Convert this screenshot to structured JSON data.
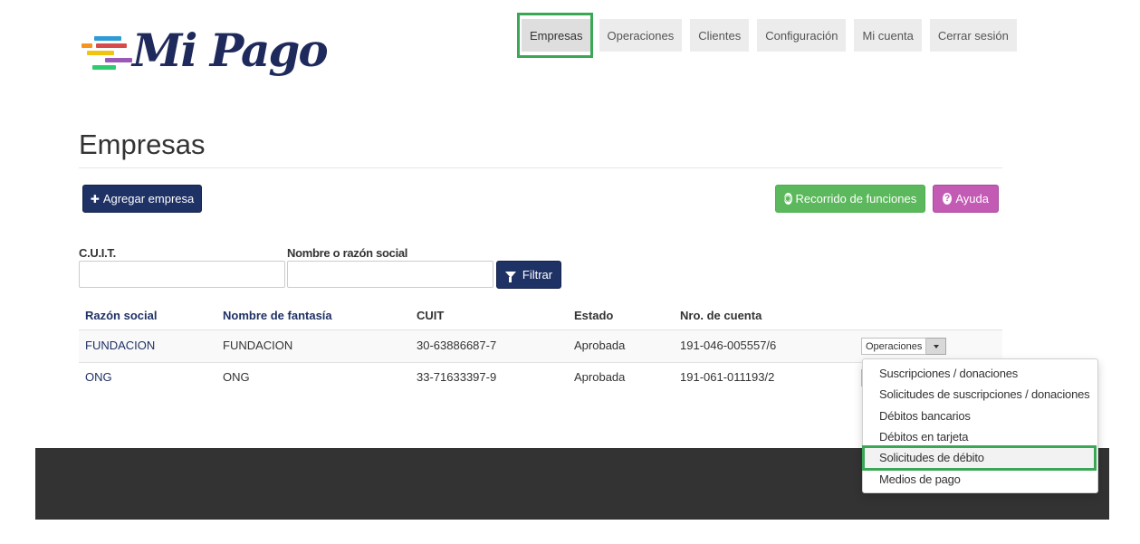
{
  "brand": {
    "name": "Mi Pago",
    "stripe_colors": [
      "#f7941d",
      "#d64c4c",
      "#9b59b6",
      "#2e9bd6",
      "#f1c40f",
      "#2ecc71"
    ],
    "text_color": "#1f2a5c"
  },
  "nav": {
    "items": [
      {
        "label": "Empresas",
        "active": true
      },
      {
        "label": "Operaciones"
      },
      {
        "label": "Clientes"
      },
      {
        "label": "Configuración"
      },
      {
        "label": "Mi cuenta"
      },
      {
        "label": "Cerrar sesión"
      }
    ]
  },
  "page": {
    "title": "Empresas"
  },
  "actions": {
    "add_company": "Agregar empresa",
    "tour": "Recorrido de funciones",
    "help": "Ayuda"
  },
  "filter": {
    "cuit_label": "C.U.I.T.",
    "cuit_value": "",
    "name_label": "Nombre o razón social",
    "name_value": "",
    "button": "Filtrar"
  },
  "table": {
    "headers": [
      "Razón social",
      "Nombre de fantasía",
      "CUIT",
      "Estado",
      "Nro. de cuenta"
    ],
    "rows": [
      [
        "FUNDACION",
        "FUNDACION",
        "30-63886687-7",
        "Aprobada",
        "191-046-005557/6"
      ],
      [
        "ONG",
        "ONG",
        "33-71633397-9",
        "Aprobada",
        "191-061-011193/2"
      ]
    ],
    "row_action": "Operaciones"
  },
  "dropdown": {
    "items": [
      "Suscripciones / donaciones",
      "Solicitudes de suscripciones / donaciones",
      "Débitos bancarios",
      "Débitos en tarjeta",
      "Solicitudes de débito",
      "Medios de pago"
    ],
    "highlighted_index": 4
  },
  "colors": {
    "primary": "#1f3265",
    "success": "#5cb85c",
    "help": "#c35ab3",
    "highlight": "#3aa757",
    "footer": "#333333"
  }
}
